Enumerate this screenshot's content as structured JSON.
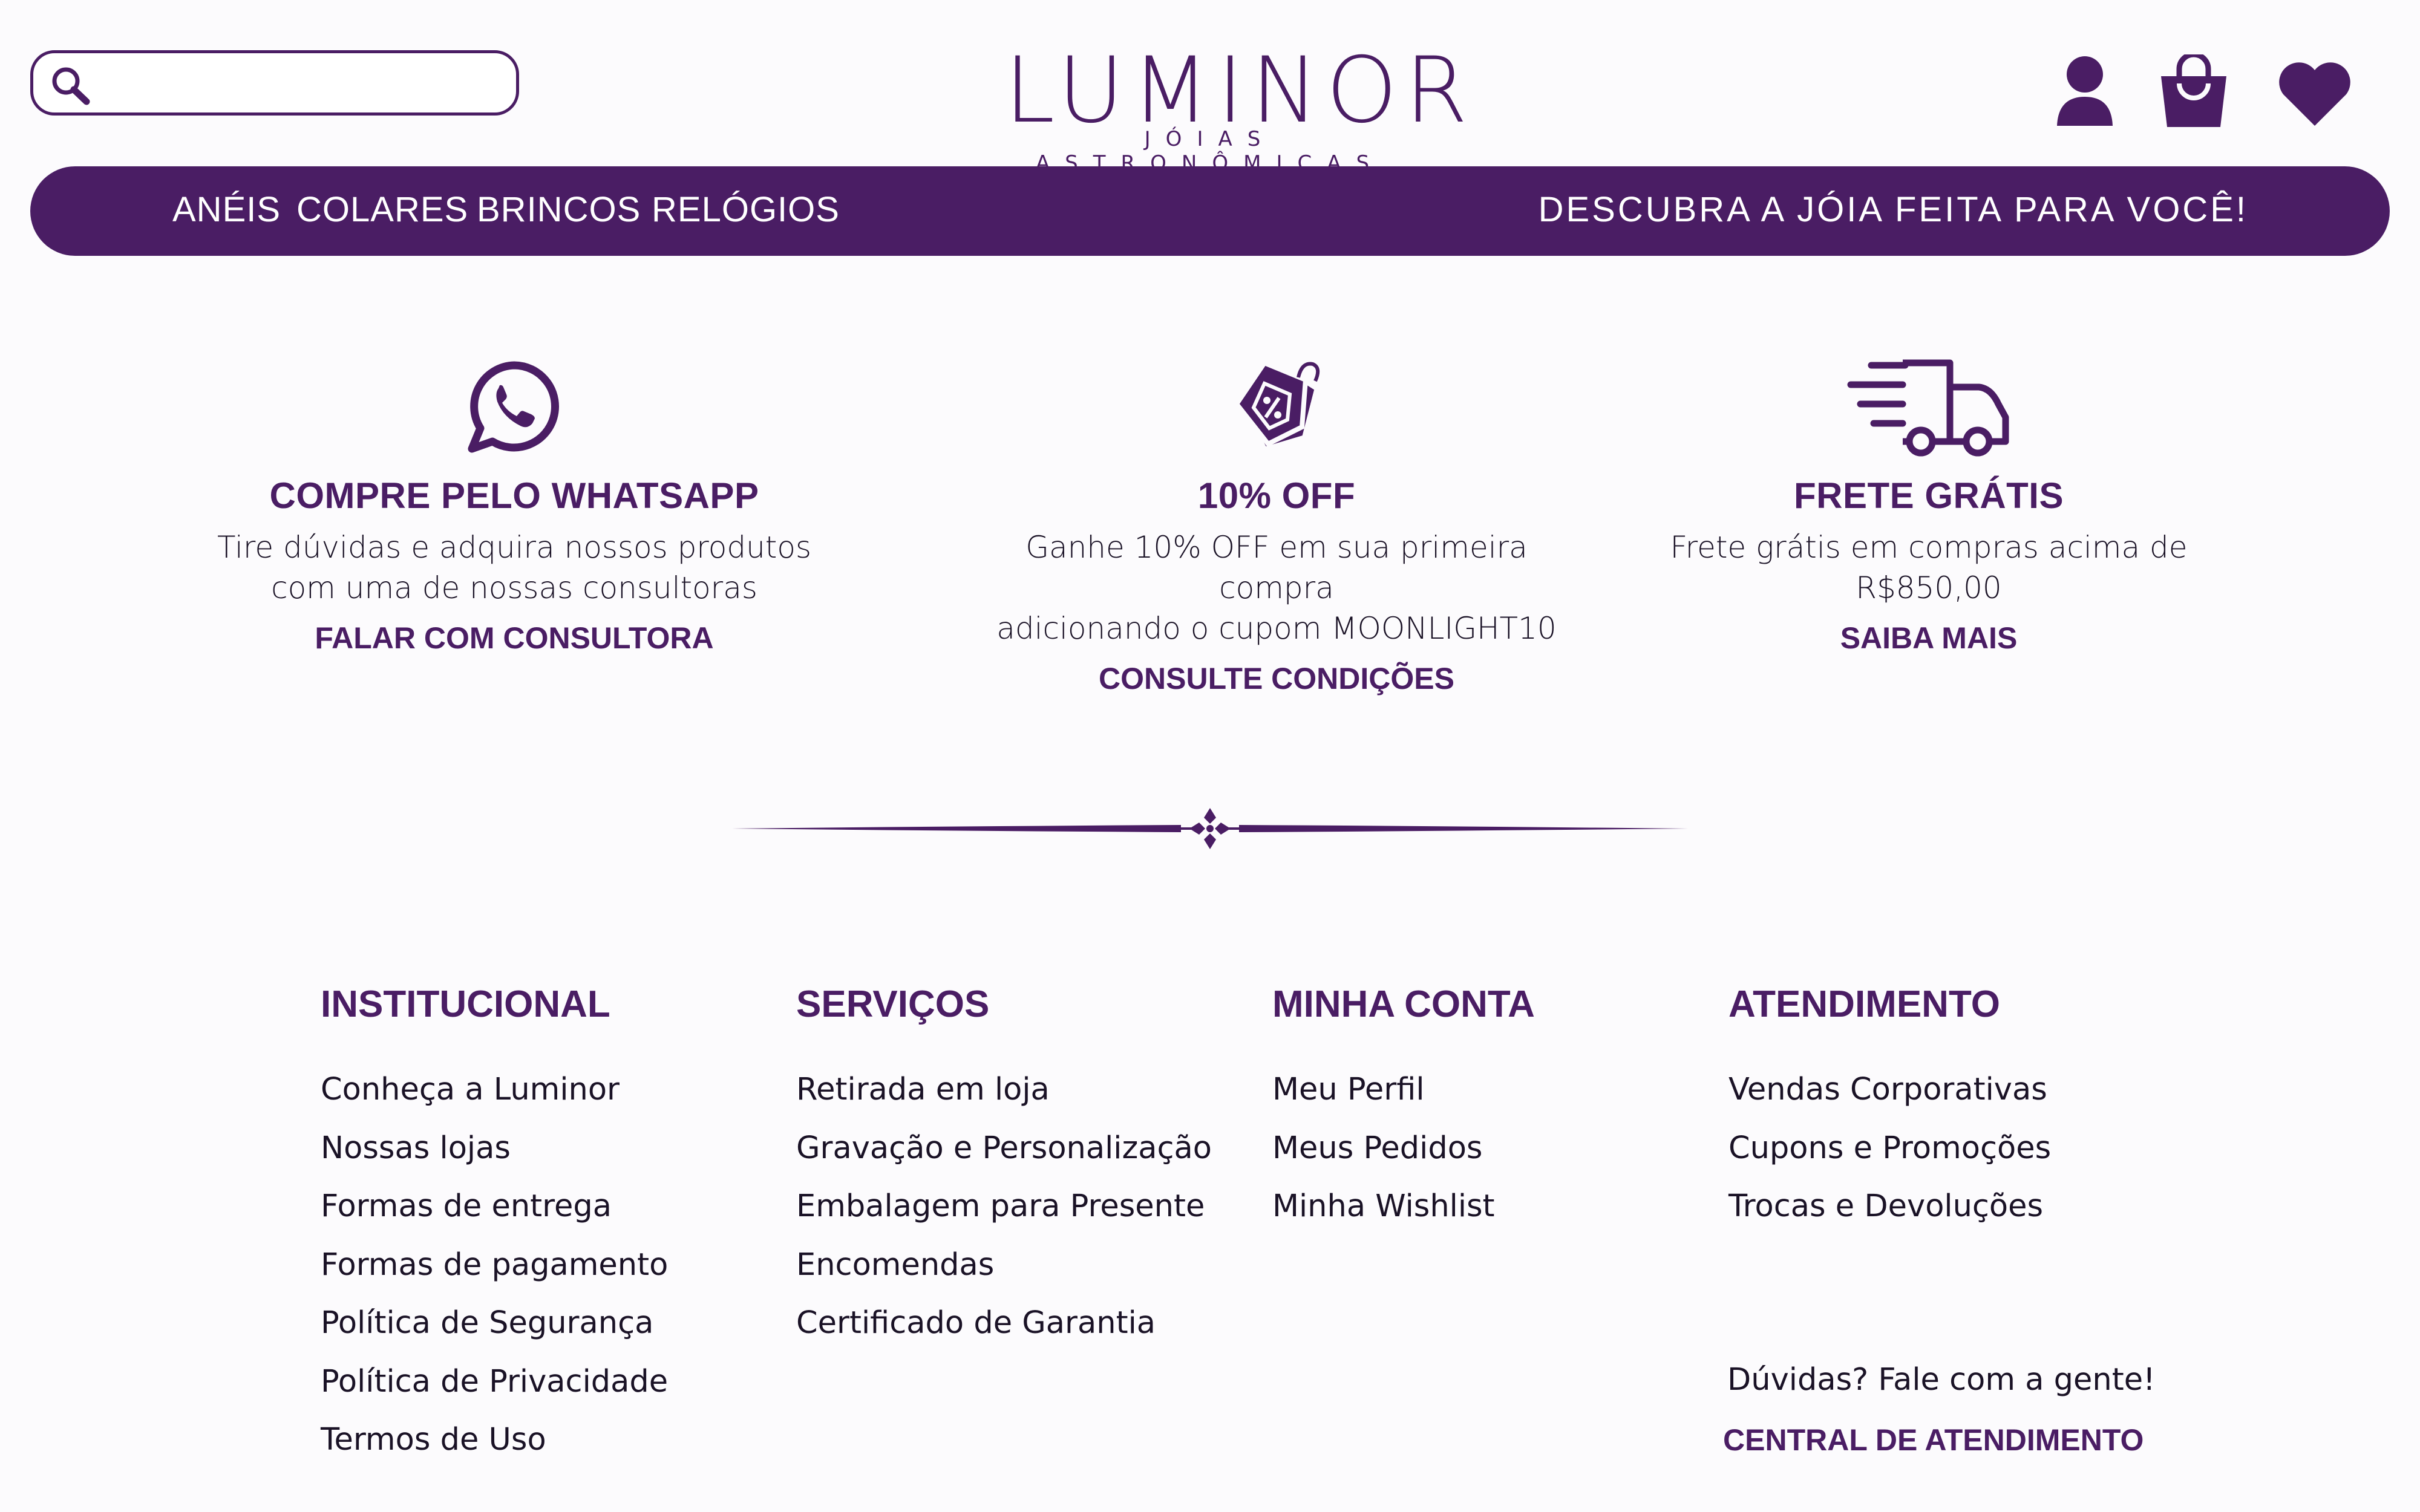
{
  "brand": {
    "name": "LUMINOR",
    "tagline": "JÓIAS ASTRONÔMICAS",
    "accent_color": "#4a1d64"
  },
  "header": {
    "search": {
      "placeholder": "",
      "icon": "search-icon"
    },
    "icons": [
      "user-icon",
      "shopping-bag-icon",
      "heart-icon"
    ]
  },
  "nav": {
    "items": [
      {
        "label": "ANÉIS"
      },
      {
        "label": "COLARES"
      },
      {
        "label": "BRINCOS"
      },
      {
        "label": "RELÓGIOS"
      }
    ],
    "promo": "DESCUBRA A JÓIA FEITA PARA VOCÊ!"
  },
  "features": [
    {
      "icon": "whatsapp-icon",
      "title": "COMPRE PELO WHATSAPP",
      "line1": "Tire dúvidas e adquira nossos produtos",
      "line2": "com uma de nossas consultoras",
      "link": "FALAR COM CONSULTORA"
    },
    {
      "icon": "discount-tag-icon",
      "title": "10% OFF",
      "line1": "Ganhe 10% OFF em sua primeira compra",
      "line2": "adicionando o cupom MOONLIGHT10",
      "link": "CONSULTE CONDIÇÕES"
    },
    {
      "icon": "delivery-truck-icon",
      "title": "FRETE GRÁTIS",
      "line1": "Frete grátis em compras acima de",
      "line2": "R$850,00",
      "link": "SAIBA MAIS"
    }
  ],
  "footer": {
    "columns": [
      {
        "title": "INSTITUCIONAL",
        "links": [
          "Conheça a Luminor",
          "Nossas lojas",
          "Formas de entrega",
          "Formas de pagamento",
          "Política de Segurança",
          "Política de Privacidade",
          "Termos de Uso"
        ]
      },
      {
        "title": "SERVIÇOS",
        "links": [
          "Retirada em loja",
          "Gravação e Personalização",
          "Embalagem para Presente",
          "Encomendas",
          "Certificado de Garantia"
        ]
      },
      {
        "title": "MINHA CONTA",
        "links": [
          "Meu Perfil",
          "Meus Pedidos",
          "Minha Wishlist"
        ]
      },
      {
        "title": "ATENDIMENTO",
        "links": [
          "Vendas Corporativas",
          "Cupons e Promoções",
          "Trocas e Devoluções"
        ]
      }
    ],
    "help_text": "Dúvidas? Fale com a gente!",
    "help_link": "CENTRAL DE ATENDIMENTO"
  }
}
